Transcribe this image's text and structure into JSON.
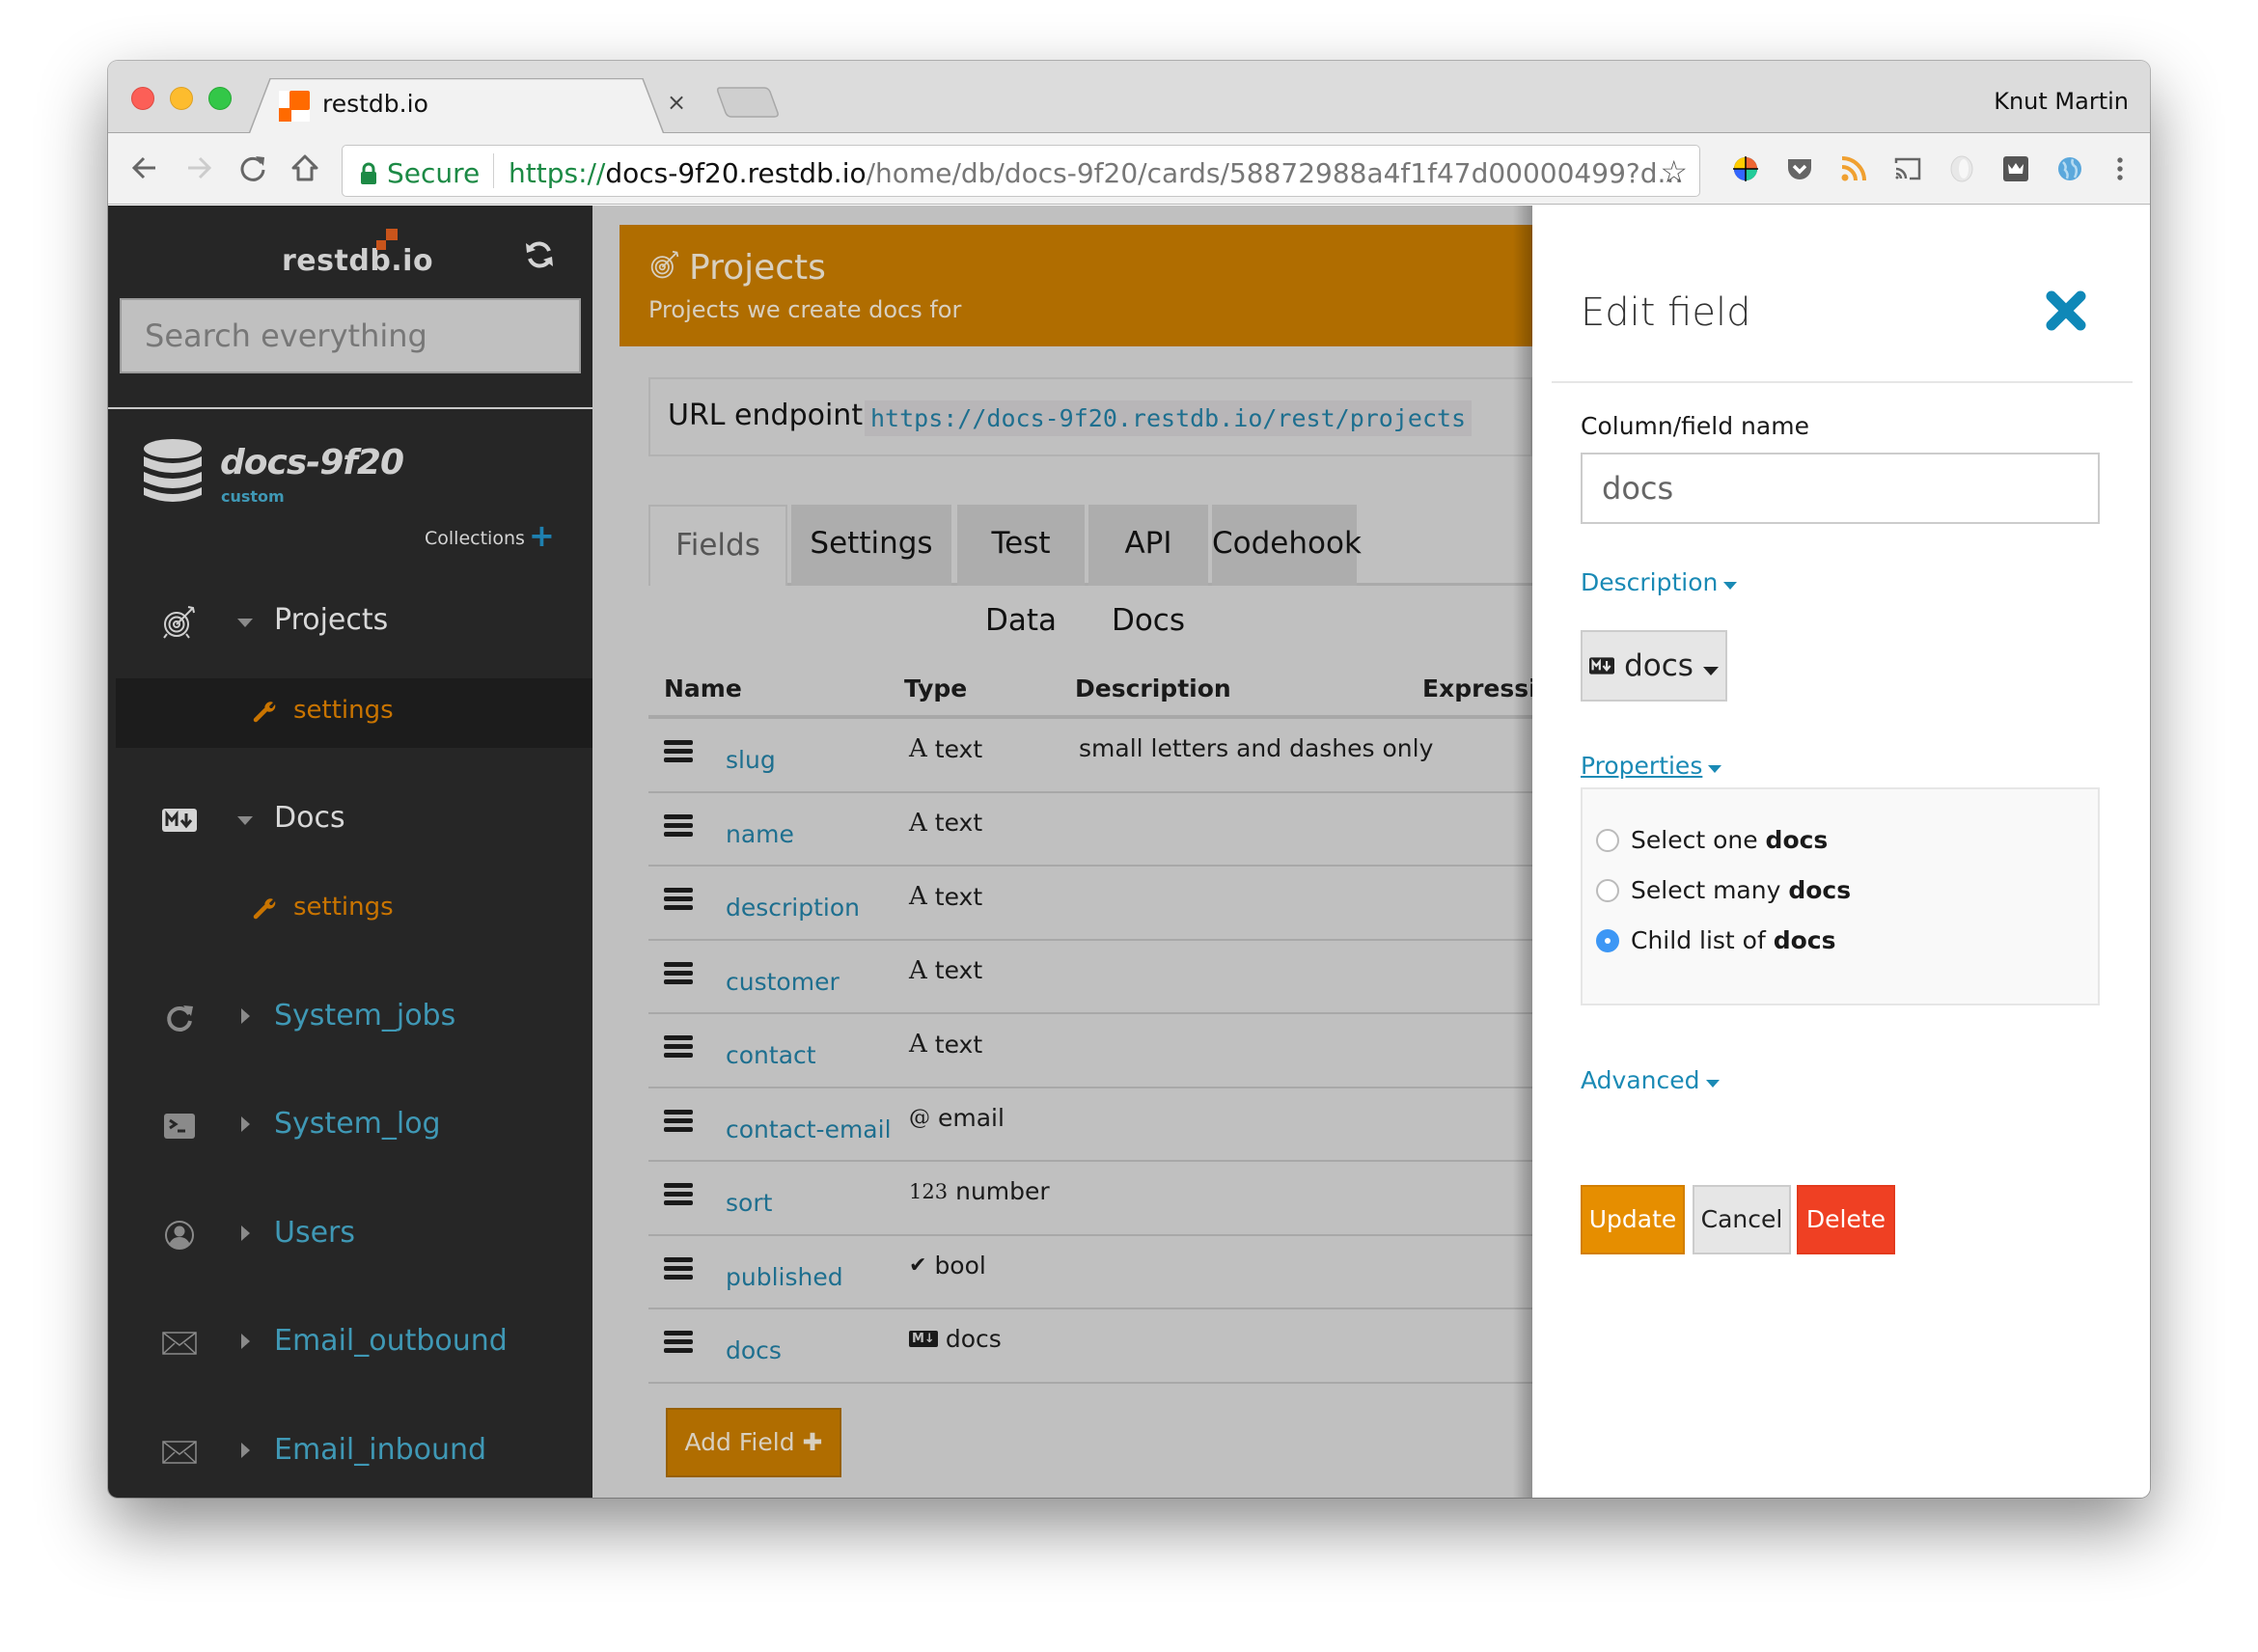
{
  "browser": {
    "tab_title": "restdb.io",
    "tab_close": "×",
    "profile_name": "Knut Martin",
    "secure_label": "Secure",
    "url_scheme": "https://",
    "url_host": "docs-9f20.restdb.io",
    "url_path": "/home/db/docs-9f20/cards/58872988a4f1f47d00000499?d...",
    "star_glyph": "☆",
    "extensions": [
      "color-picker-icon",
      "pocket-icon",
      "rss-icon",
      "cast-icon",
      "ghostery-icon",
      "crown-icon",
      "globe-icon",
      "more-menu-icon"
    ]
  },
  "sidebar": {
    "logo": "restdb.io",
    "search_placeholder": "Search everything",
    "db_name": "docs-9f20",
    "db_tag": "custom",
    "collections_label": "Collections",
    "collections_add": "+",
    "items": [
      {
        "label": "Projects",
        "icon": "target-icon",
        "expanded": true,
        "sub": "settings",
        "active_sub": true
      },
      {
        "label": "Docs",
        "icon": "markdown-icon",
        "expanded": true,
        "sub": "settings",
        "active_sub": false
      },
      {
        "label": "System_jobs",
        "icon": "refresh-icon",
        "expanded": false
      },
      {
        "label": "System_log",
        "icon": "terminal-icon",
        "expanded": false
      },
      {
        "label": "Users",
        "icon": "user-icon",
        "expanded": false
      },
      {
        "label": "Email_outbound",
        "icon": "envelope-icon",
        "expanded": false
      },
      {
        "label": "Email_inbound",
        "icon": "envelope-icon",
        "expanded": false
      }
    ]
  },
  "main": {
    "title": "Projects",
    "subtitle": "Projects we create docs for",
    "endpoint_label": "URL endpoint:",
    "endpoint_url": "https://docs-9f20.restdb.io/rest/projects",
    "tabs": [
      {
        "label": "Fields",
        "active": true
      },
      {
        "label": "Settings",
        "active": false
      },
      {
        "label": "Test Data",
        "active": false
      },
      {
        "label": "API Docs",
        "active": false
      },
      {
        "label": "Codehook",
        "active": false
      }
    ],
    "columns": [
      "Name",
      "Type",
      "Description",
      "Expression"
    ],
    "rows": [
      {
        "name": "slug",
        "type_icon": "A",
        "type": "text",
        "description": "small letters and dashes only"
      },
      {
        "name": "name",
        "type_icon": "A",
        "type": "text",
        "description": ""
      },
      {
        "name": "description",
        "type_icon": "A",
        "type": "text",
        "description": ""
      },
      {
        "name": "customer",
        "type_icon": "A",
        "type": "text",
        "description": ""
      },
      {
        "name": "contact",
        "type_icon": "A",
        "type": "text",
        "description": ""
      },
      {
        "name": "contact-email",
        "type_icon": "@",
        "type": "email",
        "description": ""
      },
      {
        "name": "sort",
        "type_icon": "123",
        "type": "number",
        "description": ""
      },
      {
        "name": "published",
        "type_icon": "✔",
        "type": "bool",
        "description": ""
      },
      {
        "name": "docs",
        "type_icon": "M↓",
        "type": "docs",
        "description": ""
      }
    ],
    "add_field_label": "Add Field ✚"
  },
  "panel": {
    "title": "Edit field",
    "field_label": "Column/field name",
    "field_value": "docs",
    "description_link": "Description",
    "type_value": "docs",
    "properties_link": "Properties",
    "radio_options": [
      {
        "prefix": "Select one ",
        "bold": "docs",
        "checked": false
      },
      {
        "prefix": "Select many ",
        "bold": "docs",
        "checked": false
      },
      {
        "prefix": "Child list of ",
        "bold": "docs",
        "checked": true
      }
    ],
    "advanced_link": "Advanced",
    "buttons": {
      "update": "Update",
      "cancel": "Cancel",
      "delete": "Delete"
    }
  },
  "colors": {
    "brand_orange": "#b06d00",
    "link_blue": "#1a8ab5",
    "update": "#e68e00",
    "delete": "#ef4023",
    "sidebar_bg": "#262626"
  }
}
